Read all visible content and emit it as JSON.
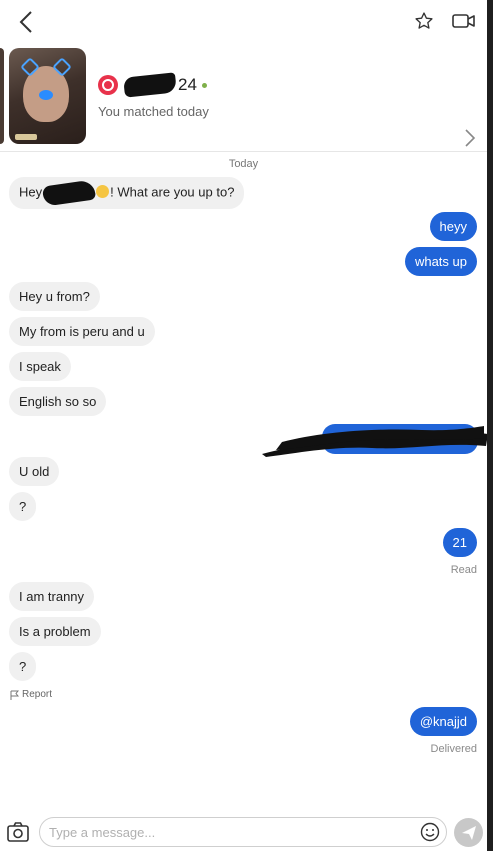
{
  "header": {
    "back_icon": "chevron-left-icon",
    "favorite_icon": "star-icon",
    "video_icon": "video-camera-icon"
  },
  "match": {
    "age": "24",
    "matched_label": "You matched today",
    "online_color": "#7fb04a",
    "brand_color": "#e8324b"
  },
  "conversation": {
    "date_label": "Today",
    "messages": [
      {
        "dir": "in",
        "text_before": "Hey",
        "text_after": "! What are you up to?"
      },
      {
        "dir": "out",
        "text": "heyy"
      },
      {
        "dir": "out",
        "text": "whats up"
      },
      {
        "dir": "in",
        "text": "Hey u from?"
      },
      {
        "dir": "in",
        "text": "My from is peru and u"
      },
      {
        "dir": "in",
        "text": "I speak"
      },
      {
        "dir": "in",
        "text": "English so so"
      },
      {
        "dir": "in",
        "text": "U old"
      },
      {
        "dir": "in",
        "text": "?"
      },
      {
        "dir": "out",
        "text": "21"
      },
      {
        "dir": "in",
        "text": "I am tranny"
      },
      {
        "dir": "in",
        "text": "Is a problem"
      },
      {
        "dir": "in",
        "text": "?"
      },
      {
        "dir": "out",
        "text": "@knajjd"
      }
    ],
    "status_read": "Read",
    "status_delivered": "Delivered",
    "report_label": "Report"
  },
  "composer": {
    "placeholder": "Type a message...",
    "camera_icon": "camera-icon",
    "emoji_icon": "emoji-icon",
    "send_icon": "send-icon"
  },
  "colors": {
    "outgoing_bubble": "#2064d8",
    "incoming_bubble": "#f0f0f0"
  }
}
